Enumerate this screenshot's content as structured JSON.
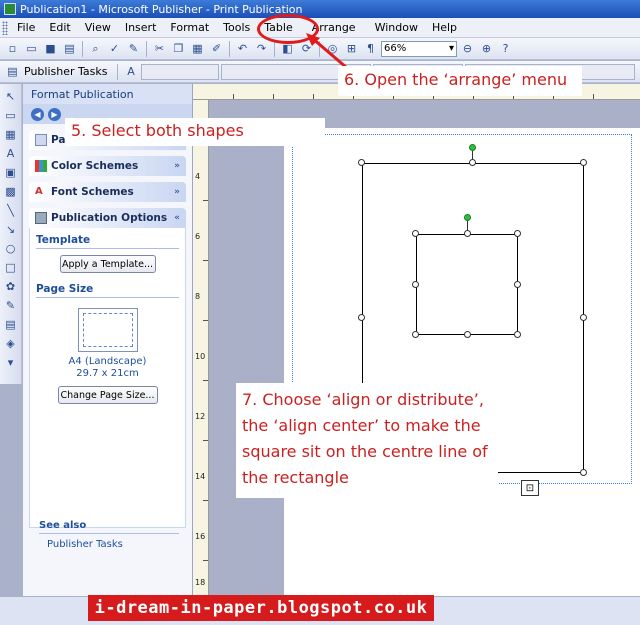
{
  "window": {
    "title": "Publication1 - Microsoft Publisher - Print Publication"
  },
  "menu": [
    {
      "label": "File"
    },
    {
      "label": "Edit"
    },
    {
      "label": "View"
    },
    {
      "label": "Insert"
    },
    {
      "label": "Format"
    },
    {
      "label": "Tools"
    },
    {
      "label": "Table"
    },
    {
      "label": "Arrange"
    },
    {
      "label": "Window"
    },
    {
      "label": "Help"
    }
  ],
  "toolbar": {
    "zoom": "66%",
    "publisher_tasks": "Publisher Tasks"
  },
  "task_pane": {
    "title": "Format Publication",
    "sections": {
      "page_options": "Page Options",
      "color_schemes": "Color Schemes",
      "font_schemes": "Font Schemes",
      "publication_options": "Publication Options"
    },
    "template_label": "Template",
    "apply_template_button": "Apply a Template...",
    "page_size_label": "Page Size",
    "page_size_name": "A4 (Landscape)",
    "page_size_dims": "29.7 x 21cm",
    "change_page_size_button": "Change Page Size...",
    "see_also_label": "See also",
    "see_also_link": "Publisher Tasks"
  },
  "ruler_left_numbers": [
    "4",
    "6",
    "8",
    "10",
    "12",
    "14",
    "16",
    "18"
  ],
  "annotations": {
    "step5": "5. Select both shapes",
    "step6": "6. Open the ‘arrange’ menu",
    "step7": "7. Choose ‘align or distribute’, the ‘align center’ to make the square sit on the centre line of the rectangle"
  },
  "watermark": "i-dream-in-paper.blogspot.co.uk",
  "colors": {
    "annotation_red": "#cc1f1f",
    "ring_red": "#e01b1b",
    "rotation_handle": "#2fbf3a"
  }
}
